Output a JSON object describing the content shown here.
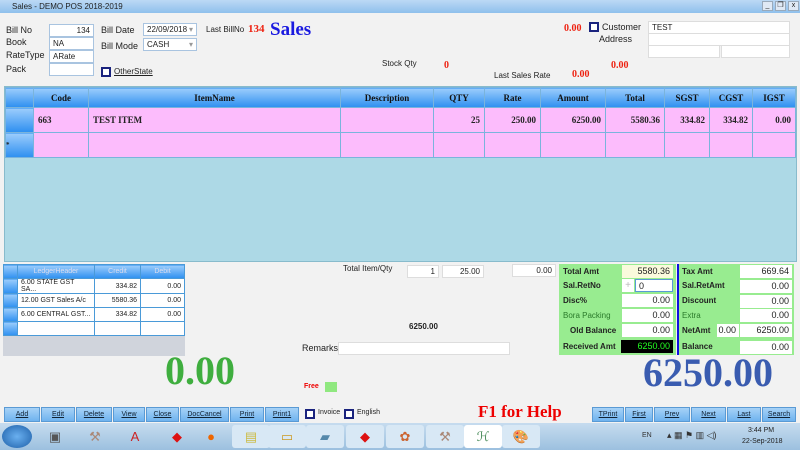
{
  "window": {
    "title": "Sales - DEMO POS 2018-2019"
  },
  "header": {
    "bill_no_label": "Bill No",
    "bill_no": "134",
    "book_label": "Book",
    "book": "NA",
    "ratetype_label": "RateType",
    "ratetype": "ARate",
    "pack_label": "Pack",
    "pack": "",
    "bill_date_label": "Bill Date",
    "bill_date": "22/09/2018",
    "bill_mode_label": "Bill Mode",
    "bill_mode": "CASH",
    "otherstate_label": "OtherState",
    "last_bill_label": "Last BillNo",
    "last_bill_no": "134",
    "form_title": "Sales",
    "stock_qty_label": "Stock Qty",
    "stock_qty": "0",
    "last_sales_rate_label": "Last Sales Rate",
    "last_sales_rate": "0.00",
    "balance_top": "0.00",
    "mid_value": "0.00",
    "customer_label": "Customer",
    "address_label": "Address",
    "customer": "TEST"
  },
  "grid": {
    "columns": [
      "Code",
      "ItemName",
      "Description",
      "QTY",
      "Rate",
      "Amount",
      "Total",
      "SGST",
      "CGST",
      "IGST"
    ],
    "rows": [
      [
        "663",
        "TEST ITEM",
        "",
        "25",
        "250.00",
        "6250.00",
        "5580.36",
        "334.82",
        "334.82",
        "0.00"
      ]
    ],
    "new_row_marker": "*"
  },
  "ledger": {
    "columns": [
      "LedgerHeader",
      "Credit",
      "Debit"
    ],
    "rows": [
      [
        "6.00 STATE GST SA...",
        "334.82",
        "0.00"
      ],
      [
        "12.00 GST Sales A/c",
        "5580.36",
        "0.00"
      ],
      [
        "6.00 CENTRAL GST...",
        "334.82",
        "0.00"
      ]
    ]
  },
  "middle": {
    "total_item_qty_label": "Total Item/Qty",
    "total_items": "1",
    "total_qty": "25.00",
    "extra_value": "0.00",
    "net_display": "6250.00",
    "remarks_label": "Remarks",
    "remarks": "",
    "big_left": "0.00",
    "free_label": "Free"
  },
  "totals": {
    "total_amt_label": "Total Amt",
    "total_amt": "5580.36",
    "salretno_label": "Sal.RetNo",
    "salretno": "0",
    "disc_label": "Disc%",
    "disc": "0.00",
    "bora_label": "Bora Packing",
    "bora": "0.00",
    "old_balance_label": "Old Balance",
    "old_balance": "0.00",
    "received_label": "Received Amt",
    "received": "6250.00",
    "tax_amt_label": "Tax Amt",
    "tax_amt": "669.64",
    "salretamt_label": "Sal.RetAmt",
    "salretamt": "0.00",
    "discount_label": "Discount",
    "discount": "0.00",
    "extra_label": "Extra",
    "extra": "0.00",
    "netamt_label": "NetAmt",
    "netamt_small": "0.00",
    "netamt": "6250.00",
    "balance_label": "Balance",
    "balance": "0.00",
    "big_right": "6250.00"
  },
  "toolbar": {
    "left": [
      "Add",
      "Edit",
      "Delete",
      "View",
      "Close",
      "DocCancel",
      "Print",
      "Print1"
    ],
    "invoice_label": "Invoice",
    "english_label": "English",
    "help": "F1 for Help",
    "right": [
      "TPrint",
      "First",
      "Prev",
      "Next",
      "Last",
      "Search"
    ]
  },
  "taskbar": {
    "lang": "EN",
    "time": "3:44 PM",
    "date": "22-Sep-2018"
  }
}
